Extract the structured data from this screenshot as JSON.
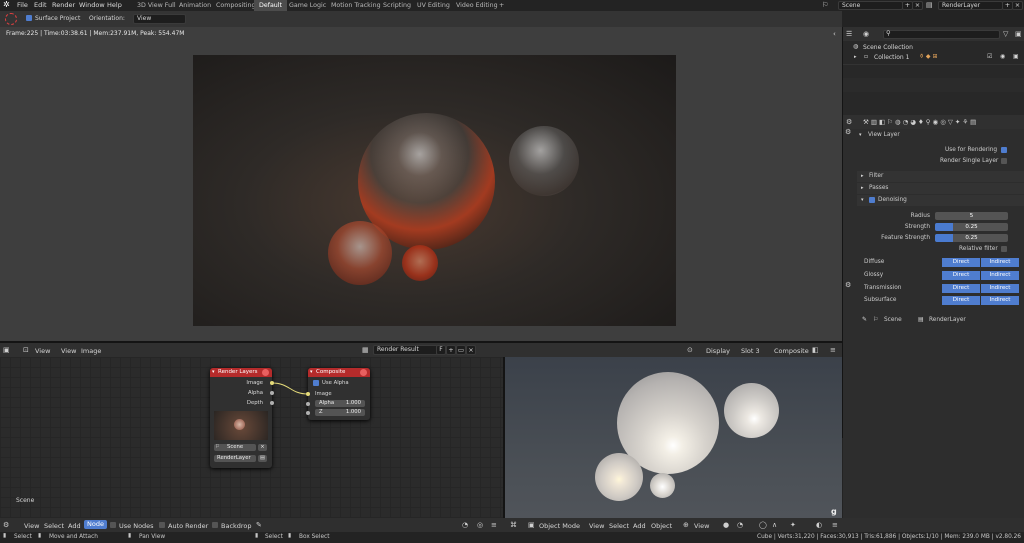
{
  "topbar": {
    "menus": [
      "File",
      "Edit",
      "Render",
      "Window",
      "Help"
    ],
    "tabs": [
      "3D View Full",
      "Animation",
      "Compositing",
      "Default",
      "Game Logic",
      "Motion Tracking",
      "Scripting",
      "UV Editing",
      "Video Editing"
    ],
    "active_tab": "Default",
    "add_tab": "+",
    "scene_label": "Scene",
    "render_layer_label": "RenderLayer"
  },
  "toolbar": {
    "surface_project": "Surface Project",
    "orientation_label": "Orientation:",
    "orientation_value": "View"
  },
  "image_editor": {
    "info": "Frame:225 | Time:03:38.61 | Mem:237.91M, Peak: 554.47M"
  },
  "image_header": {
    "view": "View",
    "view2": "View",
    "image": "Image",
    "render_result": "Render Result",
    "f_label": "F",
    "display": "Display",
    "slot": "Slot 3",
    "composite": "Composite"
  },
  "node_editor": {
    "render_layers": {
      "title": "Render Layers",
      "outputs": [
        "Image",
        "Alpha",
        "Depth"
      ],
      "scene": "Scene",
      "layer": "RenderLayer"
    },
    "composite": {
      "title": "Composite",
      "use_alpha": "Use Alpha",
      "image": "Image",
      "alpha_label": "Alpha",
      "alpha_value": "1.000",
      "z_label": "Z",
      "z_value": "1.000"
    },
    "scene_label": "Scene"
  },
  "bottom_header": {
    "left": [
      "View",
      "Select",
      "Add",
      "Node"
    ],
    "use_nodes": "Use Nodes",
    "auto_render": "Auto Render",
    "backdrop": "Backdrop",
    "object_mode": "Object Mode",
    "right": [
      "View",
      "Select",
      "Add",
      "Object"
    ],
    "view_label": "View"
  },
  "status": {
    "select": "Select",
    "move_attach": "Move and Attach",
    "pan_view": "Pan View",
    "select2": "Select",
    "box_select": "Box Select",
    "stats": "Cube | Verts:31,220 | Faces:30,913 | Tris:61,886 | Objects:1/10 | Mem: 239.0 MB | v2.80.26"
  },
  "outliner": {
    "scene_collection": "Scene Collection",
    "collection": "Collection 1"
  },
  "properties": {
    "view_layer": "View Layer",
    "use_for_rendering": "Use for Rendering",
    "render_single_layer": "Render Single Layer",
    "filter": "Filter",
    "passes": "Passes",
    "denoising": "Denoising",
    "radius_label": "Radius",
    "radius_value": "5",
    "strength_label": "Strength",
    "strength_value": "0.25",
    "feature_strength_label": "Feature Strength",
    "feature_strength_value": "0.25",
    "relative_filter": "Relative filter",
    "channels": [
      {
        "name": "Diffuse",
        "direct": "Direct",
        "indirect": "Indirect"
      },
      {
        "name": "Glossy",
        "direct": "Direct",
        "indirect": "Indirect"
      },
      {
        "name": "Transmission",
        "direct": "Direct",
        "indirect": "Indirect"
      },
      {
        "name": "Subsurface",
        "direct": "Direct",
        "indirect": "Indirect"
      }
    ],
    "footer_scene": "Scene",
    "footer_layer": "RenderLayer"
  },
  "gizmo_letter": "g",
  "colors": {
    "accent_blue": "#4f7dcf",
    "node_red": "#b52b2b",
    "bg": "#232323"
  }
}
